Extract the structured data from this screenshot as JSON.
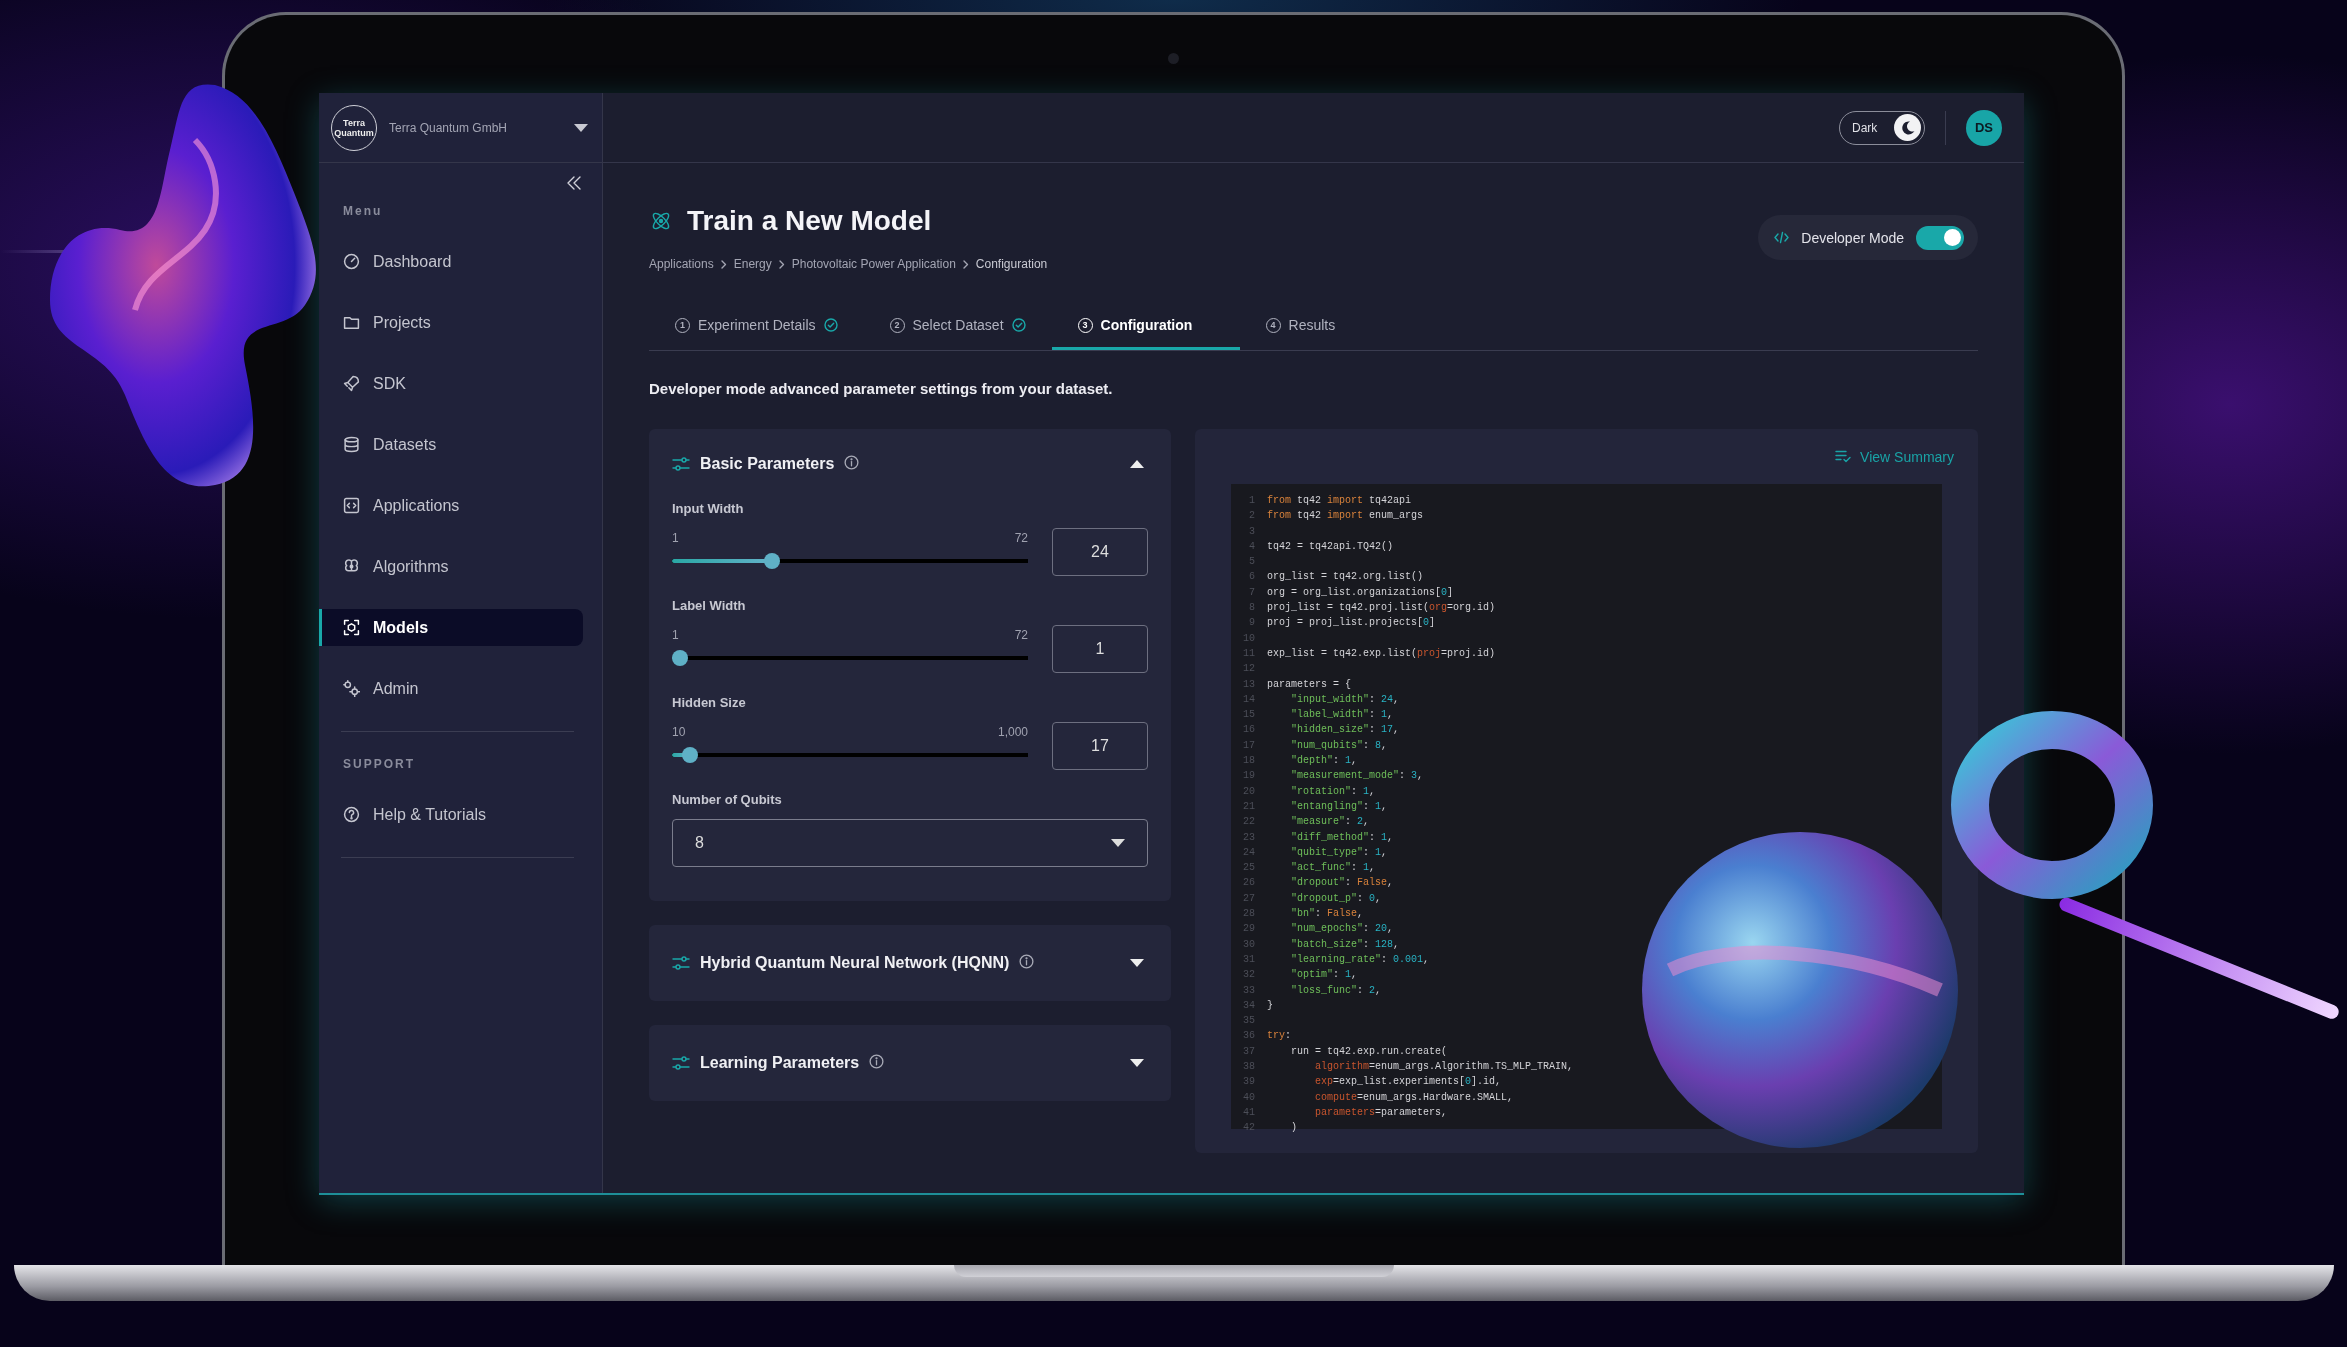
{
  "org": {
    "logo_text": "Terra Quantum",
    "name": "Terra Quantum GmbH"
  },
  "sidebar": {
    "sections": [
      {
        "label": "Menu",
        "items": [
          {
            "label": "Dashboard",
            "selected": false
          },
          {
            "label": "Projects",
            "selected": false
          },
          {
            "label": "SDK",
            "selected": false
          },
          {
            "label": "Datasets",
            "selected": false
          },
          {
            "label": "Applications",
            "selected": false
          },
          {
            "label": "Algorithms",
            "selected": false
          },
          {
            "label": "Models",
            "selected": true
          },
          {
            "label": "Admin",
            "selected": false
          }
        ]
      },
      {
        "label": "SUPPORT",
        "items": [
          {
            "label": "Help & Tutorials",
            "selected": false
          }
        ]
      }
    ]
  },
  "topbar": {
    "theme_toggle": {
      "label": "Dark",
      "on": true
    },
    "avatar": "DS"
  },
  "page": {
    "title": "Train a New Model",
    "breadcrumb": [
      "Applications",
      "Energy",
      "Photovoltaic Power Application",
      "Configuration"
    ],
    "developer_mode": {
      "label": "Developer Mode",
      "on": true
    }
  },
  "tabs": [
    {
      "number": "1",
      "label": "Experiment Details",
      "completed": true,
      "selected": false
    },
    {
      "number": "2",
      "label": "Select Dataset",
      "completed": true,
      "selected": false
    },
    {
      "number": "3",
      "label": "Configuration",
      "completed": false,
      "selected": true
    },
    {
      "number": "4",
      "label": "Results",
      "completed": false,
      "selected": false
    }
  ],
  "description": "Developer mode advanced parameter settings from your dataset.",
  "panels": [
    {
      "title": "Basic Parameters",
      "expanded": true,
      "fields": [
        {
          "kind": "slider",
          "label": "Input Width",
          "min": "1",
          "max": "72",
          "level": 0.27,
          "value": "24"
        },
        {
          "kind": "slider",
          "label": "Label Width",
          "min": "1",
          "max": "72",
          "level": 0,
          "value": "1"
        },
        {
          "kind": "slider",
          "label": "Hidden Size",
          "min": "10",
          "max": "1,000",
          "level": 0.03,
          "value": "17"
        },
        {
          "kind": "select",
          "label": "Number of Qubits",
          "value": "8"
        }
      ]
    },
    {
      "title": "Hybrid Quantum Neural Network (HQNN)",
      "expanded": false
    },
    {
      "title": "Learning Parameters",
      "expanded": false
    }
  ],
  "code_panel": {
    "link": "View Summary",
    "lines": [
      {
        "number": "1",
        "kind": "top",
        "parts": [
          {
            "kind": "keyword",
            "text": "from"
          },
          {
            "kind": "plain",
            "text": " tq42 "
          },
          {
            "kind": "keyword",
            "text": "import"
          },
          {
            "kind": "plain",
            "text": " tq42api"
          }
        ]
      },
      {
        "number": "2",
        "kind": "top",
        "parts": [
          {
            "kind": "keyword",
            "text": "from"
          },
          {
            "kind": "plain",
            "text": " tq42 "
          },
          {
            "kind": "keyword",
            "text": "import"
          },
          {
            "kind": "plain",
            "text": " enum_args"
          }
        ]
      },
      {
        "number": "3"
      },
      {
        "number": "4",
        "kind": "top",
        "parts": [
          {
            "kind": "plain",
            "text": "tq42 = tq42api.TQ42()"
          }
        ]
      },
      {
        "number": "5"
      },
      {
        "number": "6",
        "kind": "top",
        "parts": [
          {
            "kind": "plain",
            "text": "org_list = tq42.org.list()"
          }
        ]
      },
      {
        "number": "7",
        "kind": "top",
        "parts": [
          {
            "kind": "plain",
            "text": "org = org_list.organizations["
          },
          {
            "kind": "number",
            "text": "0"
          },
          {
            "kind": "plain",
            "text": "]"
          }
        ]
      },
      {
        "number": "8",
        "kind": "top",
        "parts": [
          {
            "kind": "plain",
            "text": "proj_list = tq42.proj.list("
          },
          {
            "kind": "arg",
            "text": "org"
          },
          {
            "kind": "plain",
            "text": "=org.id)"
          }
        ]
      },
      {
        "number": "9",
        "kind": "top",
        "parts": [
          {
            "kind": "plain",
            "text": "proj = proj_list.projects["
          },
          {
            "kind": "number",
            "text": "0"
          },
          {
            "kind": "plain",
            "text": "]"
          }
        ]
      },
      {
        "number": "10"
      },
      {
        "number": "11",
        "kind": "top",
        "parts": [
          {
            "kind": "plain",
            "text": "exp_list = tq42.exp.list("
          },
          {
            "kind": "arg",
            "text": "proj"
          },
          {
            "kind": "plain",
            "text": "=proj.id)"
          }
        ]
      },
      {
        "number": "12"
      },
      {
        "number": "13",
        "kind": "top",
        "parts": [
          {
            "kind": "plain",
            "text": "parameters = {"
          }
        ]
      },
      {
        "number": "14",
        "kind": "block",
        "parts": [
          {
            "kind": "string",
            "text": "\"input_width\""
          },
          {
            "kind": "plain",
            "text": ": "
          },
          {
            "kind": "number",
            "text": "24"
          },
          {
            "kind": "plain",
            "text": ","
          }
        ]
      },
      {
        "number": "15",
        "kind": "block",
        "parts": [
          {
            "kind": "string",
            "text": "\"label_width\""
          },
          {
            "kind": "plain",
            "text": ": "
          },
          {
            "kind": "number",
            "text": "1"
          },
          {
            "kind": "plain",
            "text": ","
          }
        ]
      },
      {
        "number": "16",
        "kind": "block",
        "parts": [
          {
            "kind": "string",
            "text": "\"hidden_size\""
          },
          {
            "kind": "plain",
            "text": ": "
          },
          {
            "kind": "number",
            "text": "17"
          },
          {
            "kind": "plain",
            "text": ","
          }
        ]
      },
      {
        "number": "17",
        "kind": "block",
        "parts": [
          {
            "kind": "string",
            "text": "\"num_qubits\""
          },
          {
            "kind": "plain",
            "text": ": "
          },
          {
            "kind": "number",
            "text": "8"
          },
          {
            "kind": "plain",
            "text": ","
          }
        ]
      },
      {
        "number": "18",
        "kind": "block",
        "parts": [
          {
            "kind": "string",
            "text": "\"depth\""
          },
          {
            "kind": "plain",
            "text": ": "
          },
          {
            "kind": "number",
            "text": "1"
          },
          {
            "kind": "plain",
            "text": ","
          }
        ]
      },
      {
        "number": "19",
        "kind": "block",
        "parts": [
          {
            "kind": "string",
            "text": "\"measurement_mode\""
          },
          {
            "kind": "plain",
            "text": ": "
          },
          {
            "kind": "number",
            "text": "3"
          },
          {
            "kind": "plain",
            "text": ","
          }
        ]
      },
      {
        "number": "20",
        "kind": "block",
        "parts": [
          {
            "kind": "string",
            "text": "\"rotation\""
          },
          {
            "kind": "plain",
            "text": ": "
          },
          {
            "kind": "number",
            "text": "1"
          },
          {
            "kind": "plain",
            "text": ","
          }
        ]
      },
      {
        "number": "21",
        "kind": "block",
        "parts": [
          {
            "kind": "string",
            "text": "\"entangling\""
          },
          {
            "kind": "plain",
            "text": ": "
          },
          {
            "kind": "number",
            "text": "1"
          },
          {
            "kind": "plain",
            "text": ","
          }
        ]
      },
      {
        "number": "22",
        "kind": "block",
        "parts": [
          {
            "kind": "string",
            "text": "\"measure\""
          },
          {
            "kind": "plain",
            "text": ": "
          },
          {
            "kind": "number",
            "text": "2"
          },
          {
            "kind": "plain",
            "text": ","
          }
        ]
      },
      {
        "number": "23",
        "kind": "block",
        "parts": [
          {
            "kind": "string",
            "text": "\"diff_method\""
          },
          {
            "kind": "plain",
            "text": ": "
          },
          {
            "kind": "number",
            "text": "1"
          },
          {
            "kind": "plain",
            "text": ","
          }
        ]
      },
      {
        "number": "24",
        "kind": "block",
        "parts": [
          {
            "kind": "string",
            "text": "\"qubit_type\""
          },
          {
            "kind": "plain",
            "text": ": "
          },
          {
            "kind": "number",
            "text": "1"
          },
          {
            "kind": "plain",
            "text": ","
          }
        ]
      },
      {
        "number": "25",
        "kind": "block",
        "parts": [
          {
            "kind": "string",
            "text": "\"act_func\""
          },
          {
            "kind": "plain",
            "text": ": "
          },
          {
            "kind": "number",
            "text": "1"
          },
          {
            "kind": "plain",
            "text": ","
          }
        ]
      },
      {
        "number": "26",
        "kind": "block",
        "parts": [
          {
            "kind": "string",
            "text": "\"dropout\""
          },
          {
            "kind": "plain",
            "text": ": "
          },
          {
            "kind": "keyword",
            "text": "False"
          },
          {
            "kind": "plain",
            "text": ","
          }
        ]
      },
      {
        "number": "27",
        "kind": "block",
        "parts": [
          {
            "kind": "string",
            "text": "\"dropout_p\""
          },
          {
            "kind": "plain",
            "text": ": "
          },
          {
            "kind": "number",
            "text": "0"
          },
          {
            "kind": "plain",
            "text": ","
          }
        ]
      },
      {
        "number": "28",
        "kind": "block",
        "parts": [
          {
            "kind": "string",
            "text": "\"bn\""
          },
          {
            "kind": "plain",
            "text": ": "
          },
          {
            "kind": "keyword",
            "text": "False"
          },
          {
            "kind": "plain",
            "text": ","
          }
        ]
      },
      {
        "number": "29",
        "kind": "block",
        "parts": [
          {
            "kind": "string",
            "text": "\"num_epochs\""
          },
          {
            "kind": "plain",
            "text": ": "
          },
          {
            "kind": "number",
            "text": "20"
          },
          {
            "kind": "plain",
            "text": ","
          }
        ]
      },
      {
        "number": "30",
        "kind": "block",
        "parts": [
          {
            "kind": "string",
            "text": "\"batch_size\""
          },
          {
            "kind": "plain",
            "text": ": "
          },
          {
            "kind": "number",
            "text": "128"
          },
          {
            "kind": "plain",
            "text": ","
          }
        ]
      },
      {
        "number": "31",
        "kind": "block",
        "parts": [
          {
            "kind": "string",
            "text": "\"learning_rate\""
          },
          {
            "kind": "plain",
            "text": ": "
          },
          {
            "kind": "number",
            "text": "0.001"
          },
          {
            "kind": "plain",
            "text": ","
          }
        ]
      },
      {
        "number": "32",
        "kind": "block",
        "parts": [
          {
            "kind": "string",
            "text": "\"optim\""
          },
          {
            "kind": "plain",
            "text": ": "
          },
          {
            "kind": "number",
            "text": "1"
          },
          {
            "kind": "plain",
            "text": ","
          }
        ]
      },
      {
        "number": "33",
        "kind": "block",
        "parts": [
          {
            "kind": "string",
            "text": "\"loss_func\""
          },
          {
            "kind": "plain",
            "text": ": "
          },
          {
            "kind": "number",
            "text": "2"
          },
          {
            "kind": "plain",
            "text": ","
          }
        ]
      },
      {
        "number": "34",
        "kind": "top",
        "parts": [
          {
            "kind": "plain",
            "text": "}"
          }
        ]
      },
      {
        "number": "35"
      },
      {
        "number": "36",
        "kind": "top",
        "parts": [
          {
            "kind": "keyword",
            "text": "try"
          },
          {
            "kind": "plain",
            "text": ":"
          }
        ]
      },
      {
        "number": "37",
        "kind": "block",
        "parts": [
          {
            "kind": "plain",
            "text": "run = tq42.exp.run.create("
          }
        ]
      },
      {
        "number": "38",
        "kind": "nested",
        "parts": [
          {
            "kind": "arg",
            "text": "algorithm"
          },
          {
            "kind": "plain",
            "text": "=enum_args.Algorithm.TS_MLP_TRAIN,"
          }
        ]
      },
      {
        "number": "39",
        "kind": "nested",
        "parts": [
          {
            "kind": "arg",
            "text": "exp"
          },
          {
            "kind": "plain",
            "text": "=exp_list.experiments["
          },
          {
            "kind": "number",
            "text": "0"
          },
          {
            "kind": "plain",
            "text": "].id,"
          }
        ]
      },
      {
        "number": "40",
        "kind": "nested",
        "parts": [
          {
            "kind": "arg",
            "text": "compute"
          },
          {
            "kind": "plain",
            "text": "=enum_args.Hardware.SMALL,"
          }
        ]
      },
      {
        "number": "41",
        "kind": "nested",
        "parts": [
          {
            "kind": "arg",
            "text": "parameters"
          },
          {
            "kind": "plain",
            "text": "=parameters,"
          }
        ]
      },
      {
        "number": "42",
        "kind": "block",
        "parts": [
          {
            "kind": "plain",
            "text": ")"
          }
        ]
      }
    ]
  }
}
